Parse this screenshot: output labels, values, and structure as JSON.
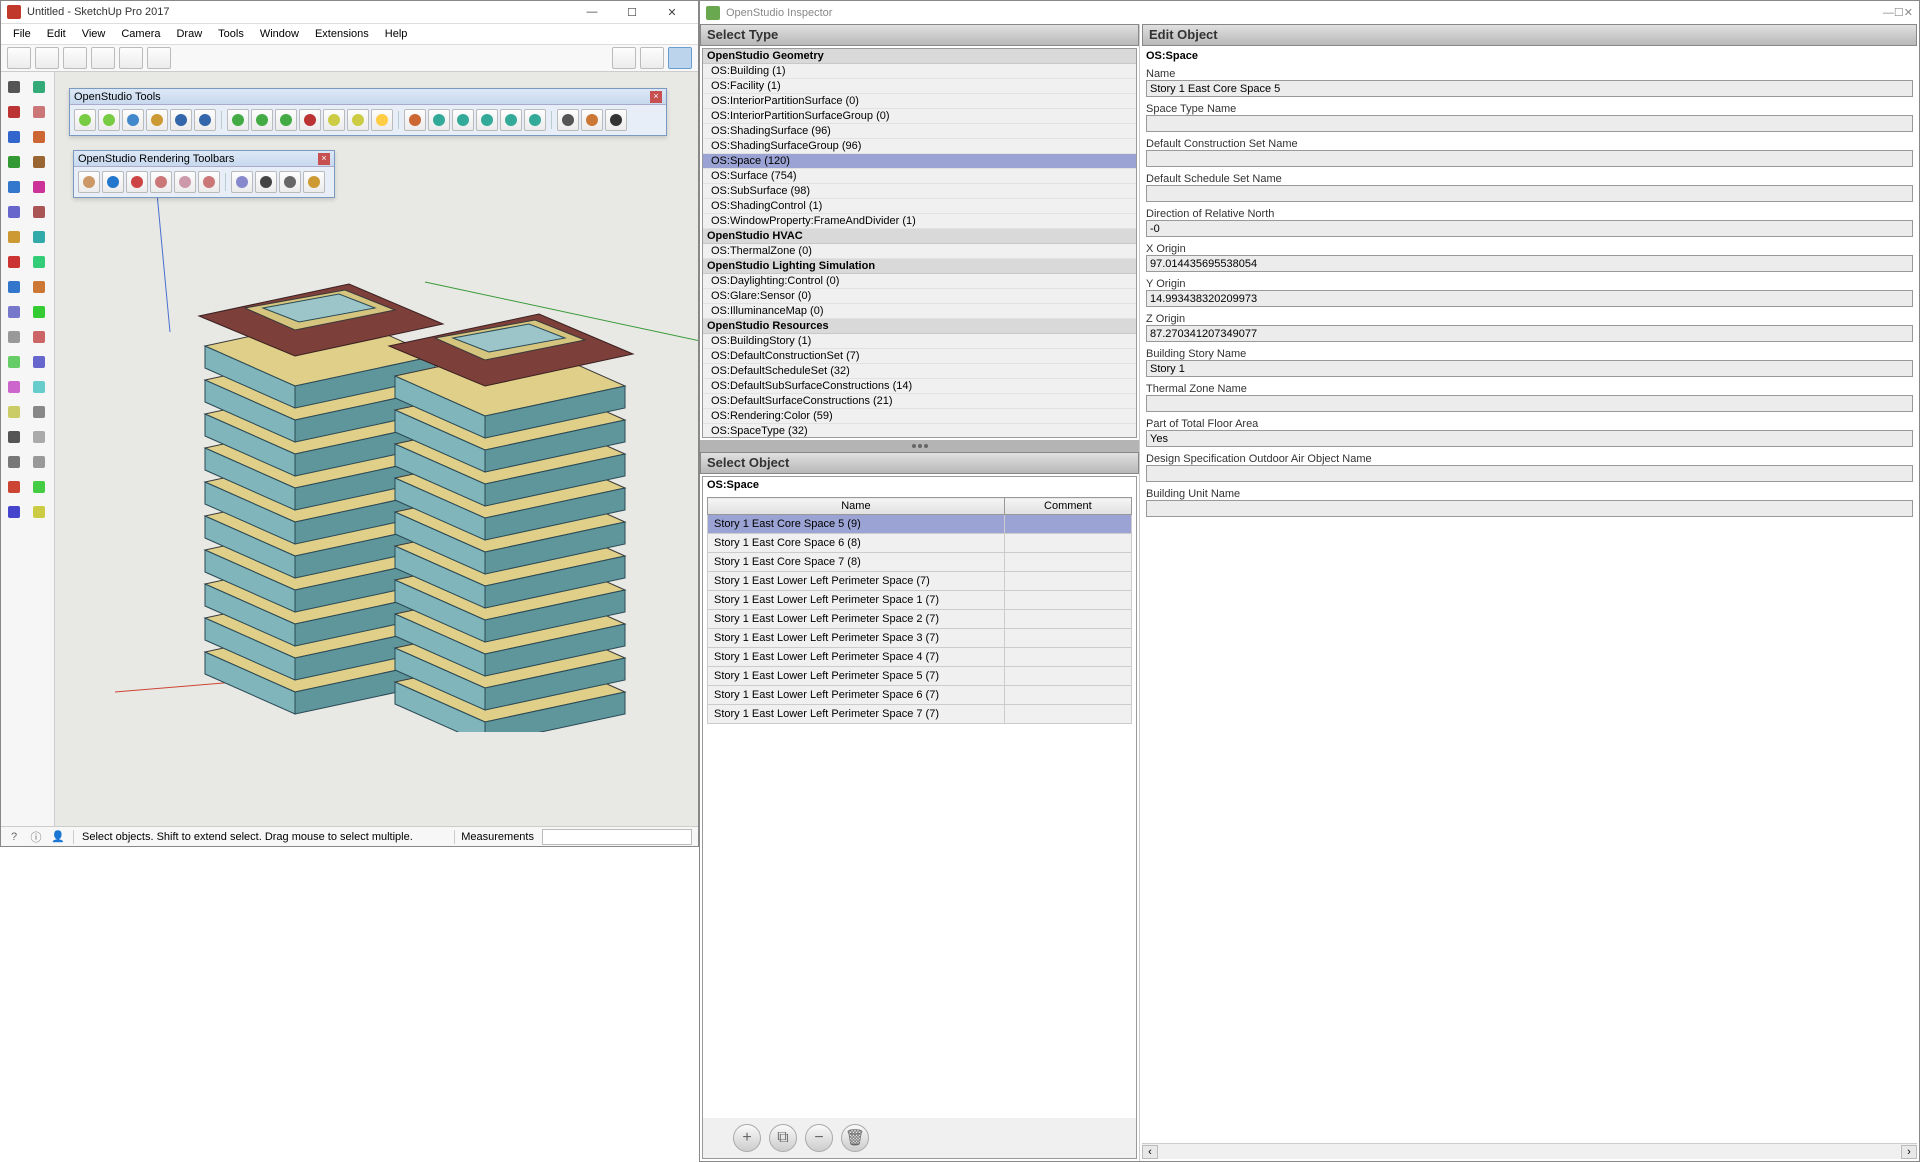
{
  "sketchup": {
    "title": "Untitled - SketchUp Pro 2017",
    "menu": [
      "File",
      "Edit",
      "View",
      "Camera",
      "Draw",
      "Tools",
      "Window",
      "Extensions",
      "Help"
    ],
    "float1_title": "OpenStudio Tools",
    "float2_title": "OpenStudio Rendering Toolbars",
    "statusbar": {
      "hint": "Select objects. Shift to extend select. Drag mouse to select multiple.",
      "measure_label": "Measurements"
    }
  },
  "inspector": {
    "title": "OpenStudio Inspector",
    "select_type": "Select Type",
    "select_object": "Select Object",
    "edit_object": "Edit Object",
    "type_groups": [
      {
        "label": "OpenStudio Geometry",
        "items": [
          {
            "t": "OS:Building (1)"
          },
          {
            "t": "OS:Facility (1)"
          },
          {
            "t": "OS:InteriorPartitionSurface (0)"
          },
          {
            "t": "OS:InteriorPartitionSurfaceGroup (0)"
          },
          {
            "t": "OS:ShadingSurface (96)"
          },
          {
            "t": "OS:ShadingSurfaceGroup (96)"
          },
          {
            "t": "OS:Space (120)",
            "sel": true
          },
          {
            "t": "OS:Surface (754)"
          },
          {
            "t": "OS:SubSurface (98)"
          },
          {
            "t": "OS:ShadingControl (1)"
          },
          {
            "t": "OS:WindowProperty:FrameAndDivider (1)"
          }
        ]
      },
      {
        "label": "OpenStudio HVAC",
        "items": [
          {
            "t": "OS:ThermalZone (0)"
          }
        ]
      },
      {
        "label": "OpenStudio Lighting Simulation",
        "items": [
          {
            "t": "OS:Daylighting:Control (0)"
          },
          {
            "t": "OS:Glare:Sensor (0)"
          },
          {
            "t": "OS:IlluminanceMap (0)"
          }
        ]
      },
      {
        "label": "OpenStudio Resources",
        "items": [
          {
            "t": "OS:BuildingStory (1)"
          },
          {
            "t": "OS:DefaultConstructionSet (7)"
          },
          {
            "t": "OS:DefaultScheduleSet (32)"
          },
          {
            "t": "OS:DefaultSubSurfaceConstructions (14)"
          },
          {
            "t": "OS:DefaultSurfaceConstructions (21)"
          },
          {
            "t": "OS:Rendering:Color (59)"
          },
          {
            "t": "OS:SpaceType (32)"
          }
        ]
      }
    ],
    "object_type": "OS:Space",
    "object_headers": {
      "name": "Name",
      "comment": "Comment"
    },
    "objects": [
      {
        "n": "Story 1 East Core Space 5 (9)",
        "sel": true
      },
      {
        "n": "Story 1 East Core Space 6 (8)"
      },
      {
        "n": "Story 1 East Core Space 7 (8)"
      },
      {
        "n": "Story 1 East Lower Left Perimeter Space (7)"
      },
      {
        "n": "Story 1 East Lower Left Perimeter Space 1 (7)"
      },
      {
        "n": "Story 1 East Lower Left Perimeter Space 2 (7)"
      },
      {
        "n": "Story 1 East Lower Left Perimeter Space 3 (7)"
      },
      {
        "n": "Story 1 East Lower Left Perimeter Space 4 (7)"
      },
      {
        "n": "Story 1 East Lower Left Perimeter Space 5 (7)"
      },
      {
        "n": "Story 1 East Lower Left Perimeter Space 6 (7)"
      },
      {
        "n": "Story 1 East Lower Left Perimeter Space 7 (7)"
      }
    ],
    "edit": {
      "subtype": "OS:Space",
      "fields": [
        {
          "l": "Name",
          "v": "Story 1 East Core Space 5"
        },
        {
          "l": "Space Type Name",
          "v": ""
        },
        {
          "l": "Default Construction Set Name",
          "v": ""
        },
        {
          "l": "Default Schedule Set Name",
          "v": ""
        },
        {
          "l": "Direction of Relative North",
          "v": "-0"
        },
        {
          "l": "X Origin",
          "v": "97.014435695538054"
        },
        {
          "l": "Y Origin",
          "v": "14.993438320209973"
        },
        {
          "l": "Z Origin",
          "v": "87.270341207349077"
        },
        {
          "l": "Building Story Name",
          "v": "Story 1"
        },
        {
          "l": "Thermal Zone Name",
          "v": ""
        },
        {
          "l": "Part of Total Floor Area",
          "v": "Yes"
        },
        {
          "l": "Design Specification Outdoor Air Object Name",
          "v": ""
        },
        {
          "l": "Building Unit Name",
          "v": ""
        }
      ]
    }
  }
}
